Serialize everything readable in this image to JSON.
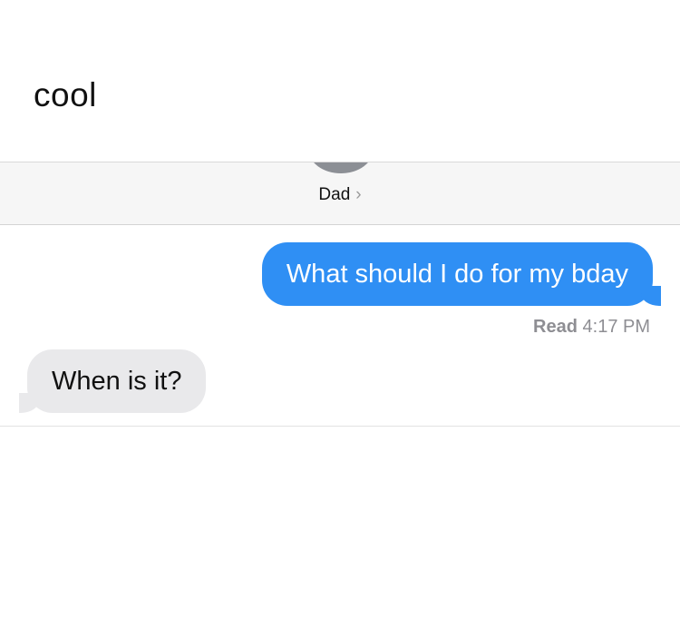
{
  "caption": "cool",
  "conversation": {
    "contact_name": "Dad",
    "chevron_glyph": "›",
    "messages": [
      {
        "direction": "sent",
        "text": "What should I do for my bday"
      },
      {
        "direction": "received",
        "text": "When is it?"
      }
    ],
    "read_receipt": {
      "label": "Read",
      "time": "4:17 PM"
    }
  },
  "colors": {
    "sent_bubble": "#2f8ff4",
    "received_bubble": "#e9e9eb",
    "header_background": "#f6f6f6",
    "avatar": "#8c8f95"
  }
}
